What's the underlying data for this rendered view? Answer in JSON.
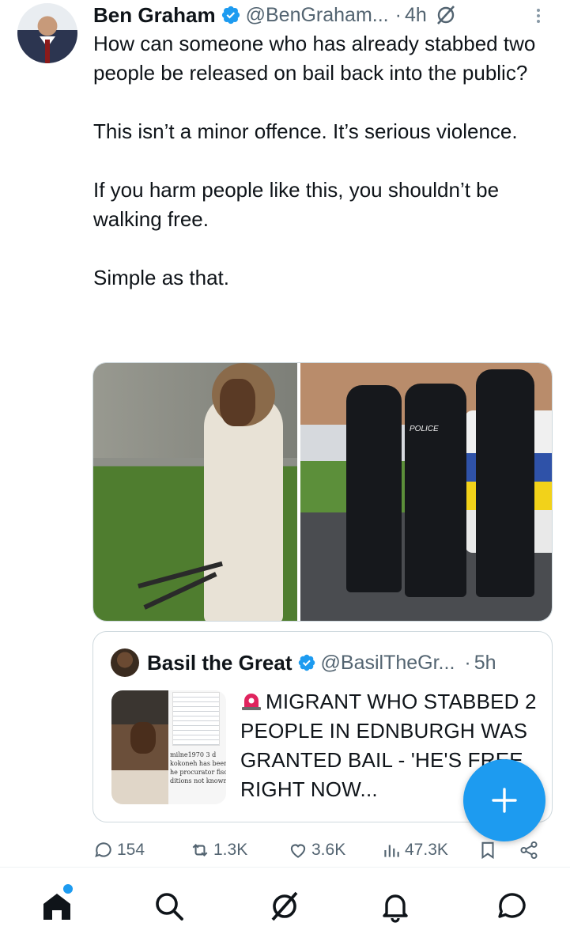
{
  "post": {
    "author_name": "Ben Graham",
    "author_handle": "@BenGraham...",
    "separator": "·",
    "time": "4h",
    "paragraphs": [
      "How can someone who has already stabbed two people be released on bail back into the public?",
      "This isn’t a minor offence. It’s serious violence.",
      "If you harm people like this, you shouldn’t be walking free.",
      "Simple as that."
    ]
  },
  "quoted_post": {
    "author_name": "Basil the Great",
    "author_handle": "@BasilTheGr...",
    "separator": "·",
    "time": "5h",
    "text": "MIGRANT WHO STABBED 2 PEOPLE IN EDNBURGH WAS GRANTED BAIL - 'HE'S FREE RIGHT NOW...",
    "thumbnail_snippet": "milne1970 3 d\nkokoneh has been\nhe procurator fisca\nditions not known"
  },
  "actions": {
    "replies": "154",
    "reposts": "1.3K",
    "likes": "3.6K",
    "views": "47.3K"
  },
  "images": {
    "left_police_text": "",
    "right_label": "POLICE"
  },
  "colors": {
    "accent": "#1d9bf0",
    "text": "#0f1419",
    "secondary_text": "#536471",
    "border": "#cfd9de"
  },
  "icons": {
    "verified": "verified-badge-icon",
    "grok": "grok-icon",
    "more": "more-vertical-icon",
    "reply": "reply-icon",
    "repost": "repost-icon",
    "like": "heart-icon",
    "views": "views-icon",
    "bookmark": "bookmark-icon",
    "share": "share-icon",
    "compose": "plus-icon",
    "home": "home-icon",
    "search": "search-icon",
    "grok_tab": "grok-icon",
    "notifications": "bell-icon",
    "messages": "message-icon"
  }
}
